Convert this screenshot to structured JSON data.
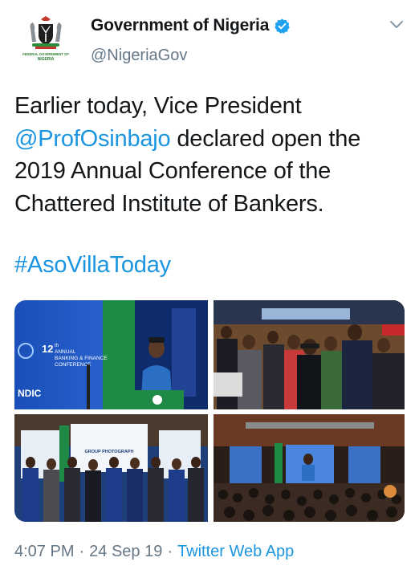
{
  "author": {
    "name": "Government of Nigeria",
    "handle": "@NigeriaGov",
    "avatar_text_top": "FEDERAL GOVERNMENT OF",
    "avatar_text_bottom": "NIGERIA",
    "verified_color": "#1da1f2"
  },
  "tweet": {
    "line1": "Earlier today, Vice President",
    "mention": "@ProfOsinbajo",
    "line2_rest": " declared open the",
    "line3": "2019 Annual Conference of the",
    "line4": "Chattered Institute of Bankers.",
    "hashtag": "#AsoVillaToday"
  },
  "media": {
    "photo1": {
      "banner_num": "12",
      "banner_sup": "th",
      "banner_line1": "ANNUAL",
      "banner_line2": "BANKING & FINANCE",
      "banner_line3": "CONFERENCE",
      "logo": "NDIC"
    },
    "photo3": {
      "screen_text": "GROUP PHOTOGRAPH"
    }
  },
  "meta": {
    "time": "4:07 PM",
    "date": "24 Sep 19",
    "source": "Twitter Web App"
  },
  "colors": {
    "link": "#1b95e0",
    "muted": "#657786",
    "text": "#14171a"
  },
  "icons": [
    "coat-of-arms-avatar",
    "verified-badge-icon",
    "chevron-down-icon"
  ]
}
